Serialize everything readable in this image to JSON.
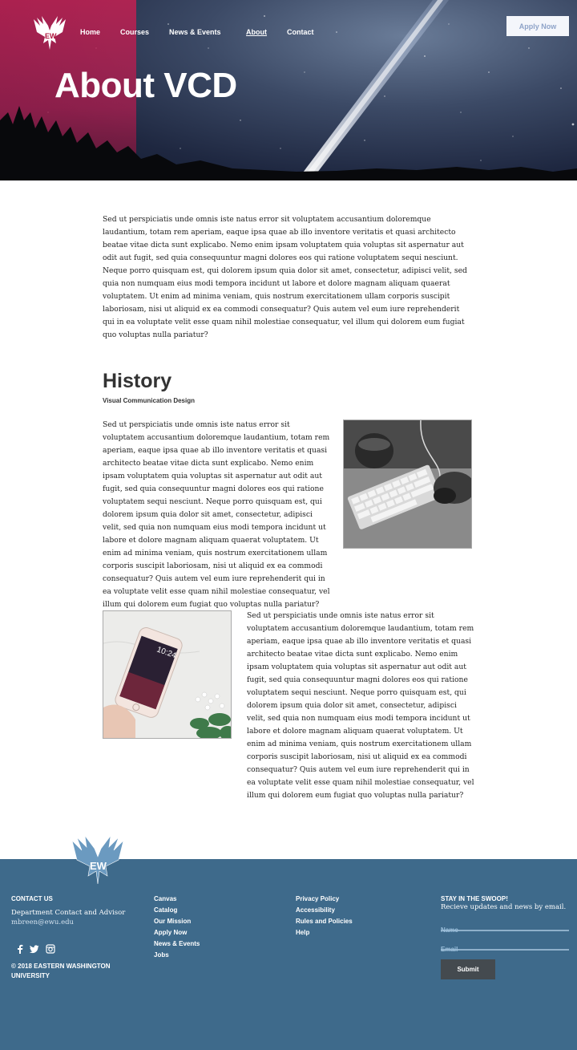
{
  "nav": {
    "items": [
      {
        "label": "Home"
      },
      {
        "label": "Courses"
      },
      {
        "label": "News & Events"
      },
      {
        "label": "About"
      },
      {
        "label": "Contact"
      }
    ],
    "active": "About",
    "apply_label": "Apply Now"
  },
  "hero": {
    "title": "About VCD"
  },
  "intro": {
    "text": "Sed ut perspiciatis unde omnis iste natus error sit voluptatem accusantium doloremque laudantium, totam rem aperiam, eaque ipsa quae ab illo inventore veritatis et quasi architecto beatae vitae dicta sunt explicabo. Nemo enim ipsam voluptatem quia voluptas sit aspernatur aut odit aut fugit, sed quia consequuntur magni dolores eos qui ratione voluptatem sequi nesciunt. Neque porro quisquam est, qui dolorem ipsum quia dolor sit amet, consectetur, adipisci velit, sed quia non numquam eius modi tempora incidunt ut labore et dolore magnam aliquam quaerat voluptatem. Ut enim ad minima veniam, quis nostrum exercitationem ullam corporis suscipit laboriosam, nisi ut aliquid ex ea commodi consequatur? Quis autem vel eum iure reprehenderit qui in ea voluptate velit esse quam nihil molestiae consequatur, vel illum qui dolorem eum fugiat quo voluptas nulla pariatur?"
  },
  "history": {
    "title": "History",
    "subtitle": "Visual Communication Design",
    "para1": "Sed ut perspiciatis unde omnis iste natus error sit voluptatem accusantium doloremque laudantium, totam rem aperiam, eaque ipsa quae ab illo inventore veritatis et quasi architecto beatae vitae dicta sunt explicabo. Nemo enim ipsam voluptatem quia voluptas sit aspernatur aut odit aut fugit, sed quia consequuntur magni dolores eos qui ratione voluptatem sequi nesciunt. Neque porro quisquam est, qui dolorem ipsum quia dolor sit amet, consectetur, adipisci velit, sed quia non numquam eius modi tempora incidunt ut labore et dolore magnam aliquam quaerat voluptatem. Ut enim ad minima veniam, quis nostrum exercitationem ullam corporis suscipit laboriosam, nisi ut aliquid ex ea commodi consequatur? Quis autem vel eum iure reprehenderit qui in ea voluptate velit esse quam nihil molestiae consequatur, vel illum qui dolorem eum fugiat quo voluptas nulla pariatur?",
    "para2": "Sed ut perspiciatis unde omnis iste natus error sit voluptatem accusantium doloremque laudantium, totam rem aperiam, eaque ipsa quae ab illo inventore veritatis et quasi architecto beatae vitae dicta sunt explicabo. Nemo enim ipsam voluptatem quia voluptas sit aspernatur aut odit aut fugit, sed quia consequuntur magni dolores eos qui ratione voluptatem sequi nesciunt. Neque porro quisquam est, qui dolorem ipsum quia dolor sit amet, consectetur, adipisci velit, sed quia non numquam eius modi tempora incidunt ut labore et dolore magnam aliquam quaerat voluptatem. Ut enim ad minima veniam, quis nostrum exercitationem ullam corporis suscipit laboriosam, nisi ut aliquid ex ea commodi consequatur? Quis autem vel eum iure reprehenderit qui in ea voluptate velit esse quam nihil molestiae consequatur, vel illum qui dolorem eum fugiat quo voluptas nulla pariatur?",
    "phone_time": "10:24"
  },
  "footer": {
    "contact_heading": "CONTACT US",
    "contact_line": "Department Contact and Advisor",
    "contact_email": "mbreen@ewu.edu",
    "copyright": "© 2018 EASTERN WASHINGTON UNIVERSITY",
    "links_col1": [
      "Canvas",
      "Catalog",
      "Our Mission",
      "Apply Now",
      "News & Events",
      "Jobs"
    ],
    "links_col2": [
      "Privacy Policy",
      "Accessibility",
      "Rules and Policies",
      "Help"
    ],
    "subscribe_heading": "STAY IN THE SWOOP!",
    "subscribe_text": "Recieve updates and news by email.",
    "name_placeholder": "Name",
    "email_placeholder": "Email",
    "submit_label": "Submit",
    "social": [
      "facebook-icon",
      "twitter-icon",
      "instagram-icon"
    ]
  },
  "colors": {
    "footer_bg": "#3e6a8b",
    "hero_accent": "#c42052",
    "apply_text": "#8ea3c8"
  }
}
